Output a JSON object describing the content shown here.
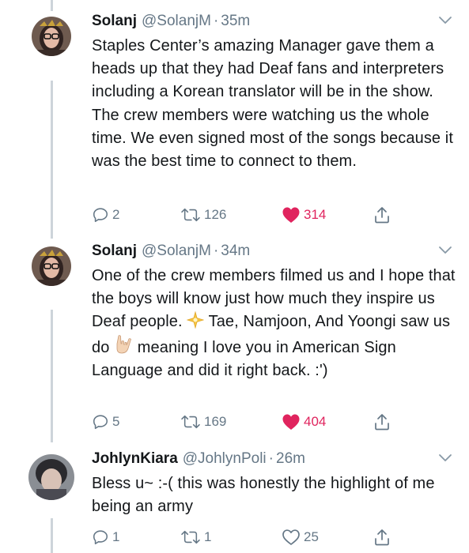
{
  "tweets": [
    {
      "name": "Solanj",
      "handle": "@SolanjM",
      "separator": "·",
      "time": "35m",
      "text": "Staples Center’s amazing Manager gave them a heads up that they had Deaf fans and interpreters including a Korean translator will be in the show. The crew members were watching us the whole time. We even signed most of the songs because it was the best time to connect to them.",
      "replies": "2",
      "retweets": "126",
      "likes": "314",
      "liked": true
    },
    {
      "name": "Solanj",
      "handle": "@SolanjM",
      "separator": "·",
      "time": "34m",
      "text_part1": "One of the crew members filmed us and I hope that the boys will know just how much they inspire us Deaf people.",
      "text_part2": "Tae, Namjoon, And Yoongi saw us do",
      "text_part3": "meaning I love you in American Sign Language and did it right back. :')",
      "emoji1": "sparkle-emoji",
      "emoji2": "love-you-gesture-emoji",
      "replies": "5",
      "retweets": "169",
      "likes": "404",
      "liked": true
    },
    {
      "name": "JohlynKiara",
      "handle": "@JohlynPoli",
      "separator": "·",
      "time": "26m",
      "text": "Bless u~ :-( this was honestly the highlight of me being an army",
      "replies": "1",
      "retweets": "1",
      "likes": "25",
      "liked": false
    }
  ],
  "colors": {
    "like_active": "#e0245e",
    "muted": "#657786",
    "thread_line": "#cdd4da",
    "text": "#14171a"
  },
  "icons": [
    "reply-icon",
    "retweet-icon",
    "like-icon",
    "share-icon",
    "chevron-down-icon"
  ]
}
